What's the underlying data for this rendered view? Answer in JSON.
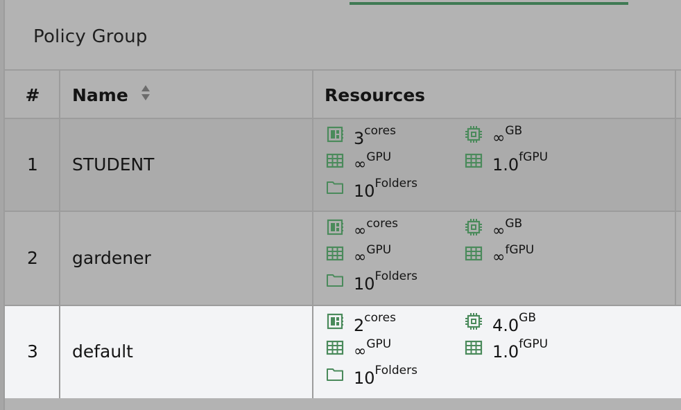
{
  "title": "Policy Group",
  "columns": {
    "index": "#",
    "name": "Name",
    "resources": "Resources"
  },
  "colors": {
    "accent": "#3f7a54",
    "icon_green": "#4a8a5b",
    "selected_row_bg": "#f3f4f6"
  },
  "rows": [
    {
      "index": "1",
      "name": "STUDENT",
      "selected": false,
      "cpu": {
        "value": "3",
        "unit": "cores"
      },
      "mem": {
        "value": "∞",
        "unit": "GB"
      },
      "gpu": {
        "value": "∞",
        "unit": "GPU"
      },
      "fgpu": {
        "value": "1.0",
        "unit": "fGPU"
      },
      "folders": {
        "value": "10",
        "unit": "Folders"
      }
    },
    {
      "index": "2",
      "name": "gardener",
      "selected": false,
      "cpu": {
        "value": "∞",
        "unit": "cores"
      },
      "mem": {
        "value": "∞",
        "unit": "GB"
      },
      "gpu": {
        "value": "∞",
        "unit": "GPU"
      },
      "fgpu": {
        "value": "∞",
        "unit": "fGPU"
      },
      "folders": {
        "value": "10",
        "unit": "Folders"
      }
    },
    {
      "index": "3",
      "name": "default",
      "selected": true,
      "cpu": {
        "value": "2",
        "unit": "cores"
      },
      "mem": {
        "value": "4.0",
        "unit": "GB"
      },
      "gpu": {
        "value": "∞",
        "unit": "GPU"
      },
      "fgpu": {
        "value": "1.0",
        "unit": "fGPU"
      },
      "folders": {
        "value": "10",
        "unit": "Folders"
      }
    }
  ]
}
